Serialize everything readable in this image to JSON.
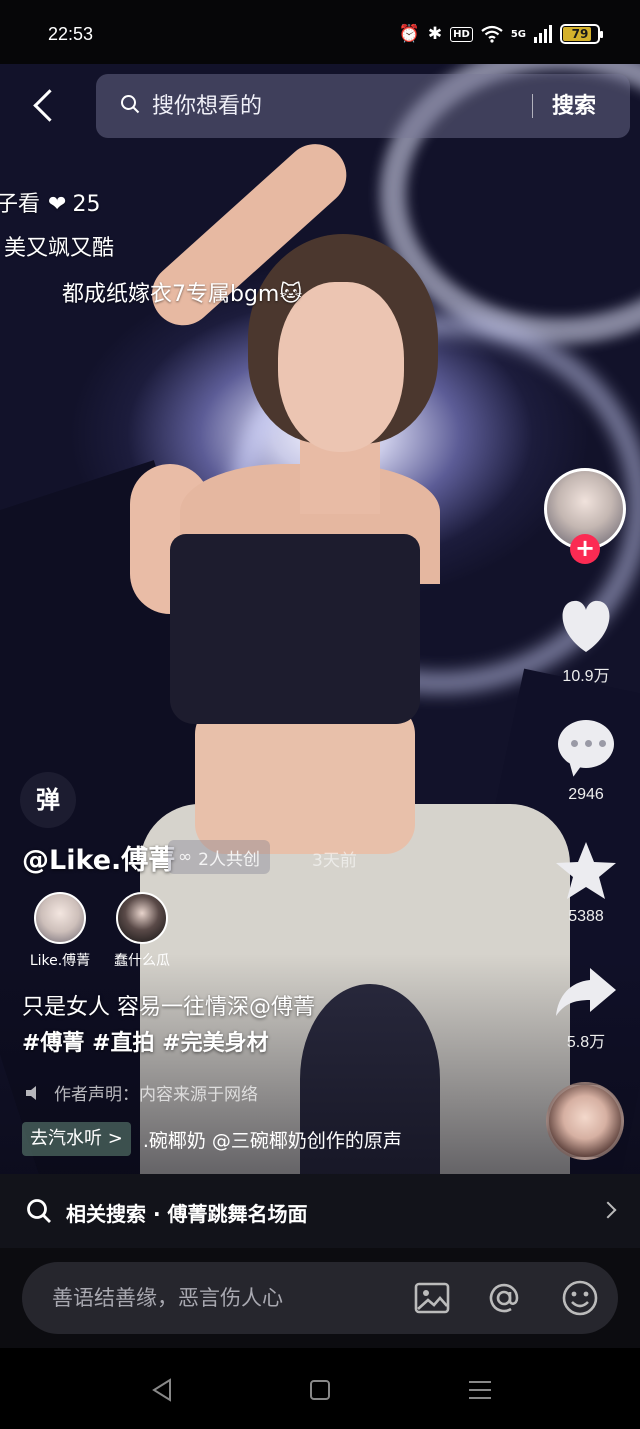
{
  "status_bar": {
    "time": "22:53",
    "icons": [
      "alarm-icon",
      "bluetooth-icon",
      "hd-icon",
      "wifi-icon",
      "signal-icon",
      "battery-icon"
    ],
    "hd_label": "HD",
    "network_label": "5G",
    "battery": "79",
    "battery_level": 0.79
  },
  "search": {
    "placeholder": "搜你想看的",
    "button_label": "搜索"
  },
  "danmaku": [
    {
      "text": "子看",
      "count": "25"
    },
    {
      "text": "美又飒又酷"
    },
    {
      "text": "都成纸嫁衣7专属bgm🐱"
    }
  ],
  "rail": {
    "likes": "10.9万",
    "comments": "2946",
    "favorites": "5388",
    "shares": "5.8万",
    "follow_symbol": "+"
  },
  "author": {
    "danmaku_toggle": "弹",
    "name": "@Like.傅菁",
    "coop_label": "2人共创",
    "time_ago": "3天前",
    "coauthors": [
      {
        "label": "Like.傅菁"
      },
      {
        "label": "蠢什么瓜"
      }
    ]
  },
  "caption": {
    "line1": "只是女人 容易一往情深@傅菁",
    "tags": "#傅菁 #直拍 #完美身材",
    "declaration": "作者声明：内容来源于网络"
  },
  "music": {
    "listen_label": "去汽水听 >",
    "text": ".碗椰奶   @三碗椰奶创作的原声"
  },
  "related": {
    "text": "相关搜索 · 傅菁跳舞名场面"
  },
  "comment": {
    "placeholder": "善语结善缘，恶言伤人心"
  },
  "colors": {
    "follow_red": "#fb2b53",
    "battery_yellow": "#d4b12c",
    "background": "#0b0b12"
  }
}
